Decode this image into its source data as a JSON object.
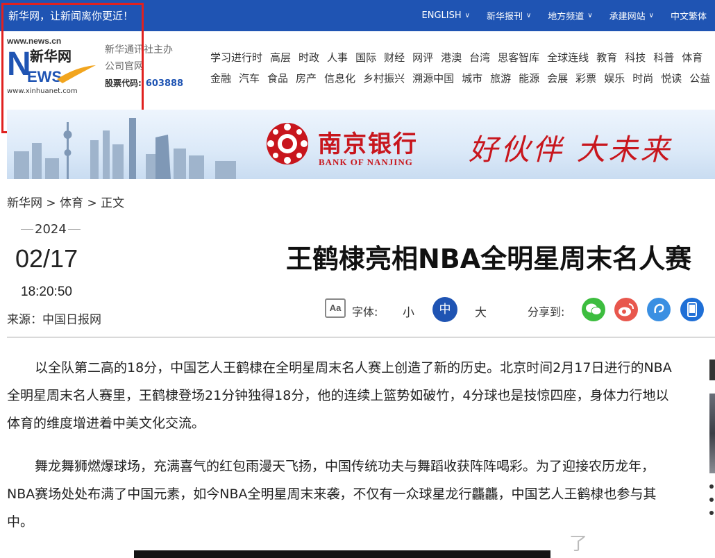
{
  "topbar": {
    "slogan": "新华网，让新闻离你更近！",
    "nav": [
      {
        "label": "ENGLISH",
        "has_dropdown": true
      },
      {
        "label": "新华报刊",
        "has_dropdown": true
      },
      {
        "label": "地方频道",
        "has_dropdown": true
      },
      {
        "label": "承建网站",
        "has_dropdown": true
      },
      {
        "label": "中文繁体",
        "has_dropdown": false
      }
    ],
    "nav_chevron": "∨",
    "colors": {
      "bar": "#1f54b3",
      "text": "#ffffff"
    }
  },
  "logo": {
    "url_top": "www.news.cn",
    "brand": "新华网",
    "brand_en_n": "N",
    "brand_en_rest": "EWS",
    "url_bottom": "www.xinhuanet.com"
  },
  "sponsor": {
    "line1": "新华通讯社主办",
    "line2": "公司官网",
    "stock_label": "股票代码:",
    "stock_code": "603888"
  },
  "channels": {
    "row1": [
      "学习进行时",
      "高层",
      "时政",
      "人事",
      "国际",
      "财经",
      "网评",
      "港澳",
      "台湾",
      "思客智库",
      "全球连线",
      "教育",
      "科技",
      "科普",
      "体育"
    ],
    "row2": [
      "金融",
      "汽车",
      "食品",
      "房产",
      "信息化",
      "乡村振兴",
      "溯源中国",
      "城市",
      "旅游",
      "能源",
      "会展",
      "彩票",
      "娱乐",
      "时尚",
      "悦读",
      "公益"
    ]
  },
  "banner": {
    "bank_name": "南京银行",
    "bank_en": "BANK OF NANJING",
    "slogan": "好伙伴 大未来",
    "brand_color": "#c8161d"
  },
  "breadcrumb": {
    "home": "新华网",
    "sep": " > ",
    "section": "体育",
    "current": "正文"
  },
  "meta": {
    "year": "2024",
    "month_day": "02/17",
    "time": "18:20:50",
    "source": "来源：中国日报网"
  },
  "article": {
    "title": "王鹤棣亮相NBA全明星周末名人赛",
    "paragraphs": [
      "以全队第二高的18分，中国艺人王鹤棣在全明星周末名人赛上创造了新的历史。北京时间2月17日进行的NBA全明星周末名人赛里，王鹤棣登场21分钟独得18分，他的连续上篮势如破竹，4分球也是技惊四座，身体力行地以体育的维度增进着中美文化交流。",
      "舞龙舞狮燃爆球场，充满喜气的红包雨漫天飞扬，中国传统功夫与舞蹈收获阵阵喝彩。为了迎接农历龙年，NBA赛场处处布满了中国元素，如今NBA全明星周末来袭，不仅有一众球星龙行龘龘，中国艺人王鹤棣也参与其中。"
    ]
  },
  "tools": {
    "font_icon": "Aa",
    "font_label": "字体:",
    "font_small": "小",
    "font_mid": "中",
    "font_large": "大",
    "share_label": "分享到:",
    "share_targets": [
      "wechat",
      "weibo",
      "link",
      "mobile"
    ]
  },
  "watermark": "了"
}
